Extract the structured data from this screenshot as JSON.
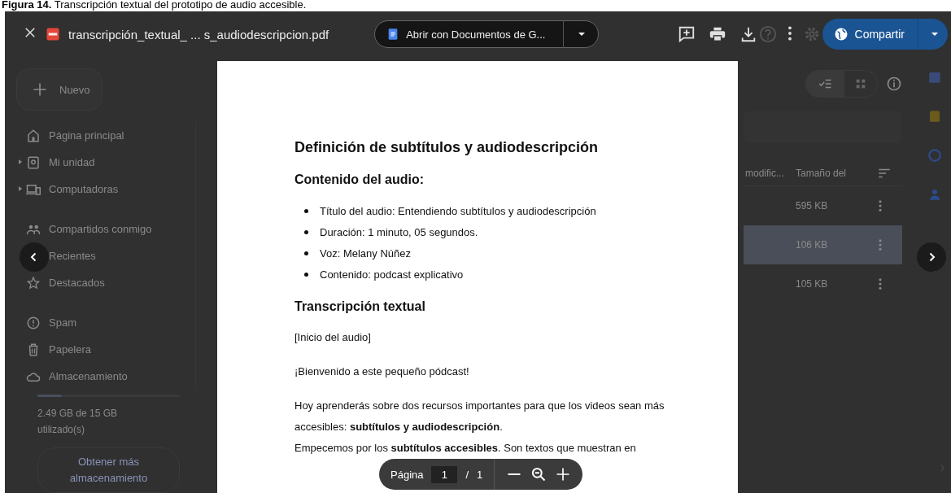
{
  "caption": "**Figura 14.** Transcripción textual del prototipo de audio accesible.",
  "viewer": {
    "file_name": "transcripción_textual_ ... s_audiodescripcion.pdf",
    "open_with": "Abrir con Documentos de G...",
    "share": "Compartir"
  },
  "drive": {
    "new_button": "Nuevo",
    "nav_groups": [
      [
        {
          "label": "Página principal",
          "expandable": false
        },
        {
          "label": "Mi unidad",
          "expandable": true
        },
        {
          "label": "Computadoras",
          "expandable": true
        }
      ],
      [
        {
          "label": "Compartidos conmigo",
          "expandable": false
        },
        {
          "label": "Recientes",
          "expandable": false
        },
        {
          "label": "Destacados",
          "expandable": false
        }
      ],
      [
        {
          "label": "Spam",
          "expandable": false
        },
        {
          "label": "Papelera",
          "expandable": false
        },
        {
          "label": "Almacenamiento",
          "expandable": false
        }
      ]
    ],
    "storage": {
      "level": 0.17,
      "text": "2.49 GB de 15 GB utilizado(s)",
      "button": "Obtener más almacenamiento"
    },
    "view_toggle": [
      {
        "selected": true
      },
      {
        "selected": false
      }
    ],
    "files": {
      "columns": [
        "modific...",
        "Tamaño del"
      ],
      "rows": [
        {
          "size": "595 KB",
          "selected": false
        },
        {
          "size": "106 KB",
          "selected": true
        },
        {
          "size": "105 KB",
          "selected": false
        }
      ]
    }
  },
  "pdf": {
    "title": "Definición de subtítulos y audiodescripción",
    "subtitle": "Contenido del audio:",
    "bullets": [
      "Título del audio: Entendiendo subtítulos y audiodescripción",
      "Duración: 1 minuto, 05 segundos.",
      "Voz: Melany Núñez",
      "Contenido: podcast explicativo"
    ],
    "heading": "Transcripción textual",
    "paragraphs": [
      "[Inicio del audio]",
      "¡Bienvenido a este pequeño pódcast!",
      "Hoy aprenderás sobre dos recursos importantes para que los videos sean más accesibles: **subtítulos y audiodescripción**.",
      "Empecemos por los **subtítulos accesibles**. Son textos que muestran en"
    ]
  },
  "page_bar": {
    "label": "Página",
    "page": "1",
    "separator": "/",
    "total": "1"
  }
}
